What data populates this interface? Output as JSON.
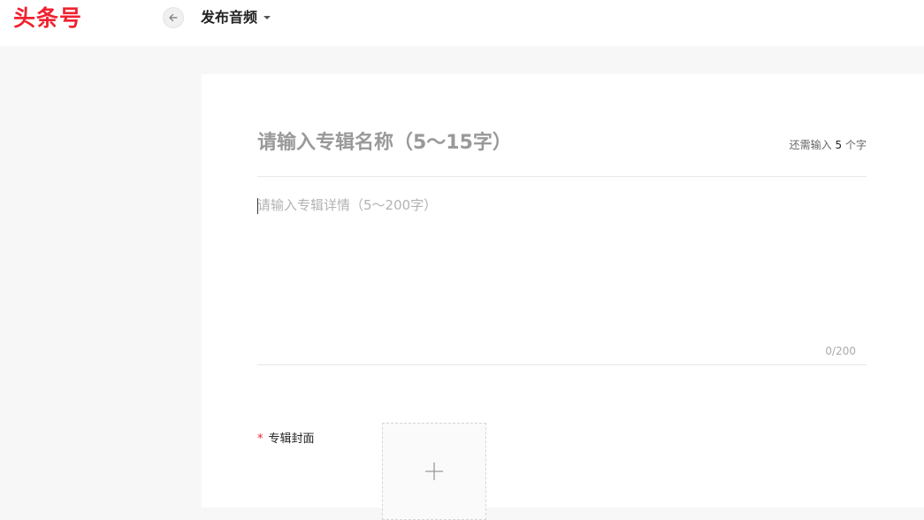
{
  "header": {
    "logo_text": "头条号",
    "back_icon": "arrow-left-icon",
    "page_title": "发布音频",
    "dropdown_icon": "caret-down-icon"
  },
  "form": {
    "title_placeholder": "请输入专辑名称（5～15字）",
    "title_remaining_prefix": "还需输入",
    "title_remaining_count": "5",
    "title_remaining_suffix": "个字",
    "description_placeholder": "请输入专辑详情（5～200字）",
    "description_counter": "0/200",
    "cover_required_mark": "*",
    "cover_label": "专辑封面",
    "cover_upload_icon": "plus-icon"
  },
  "colors": {
    "brand_red": "#f0212f",
    "page_bg": "#f7f7f7",
    "card_bg": "#ffffff"
  }
}
